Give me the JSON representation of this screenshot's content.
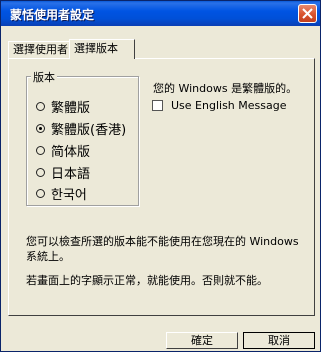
{
  "window": {
    "title": "蒙恬使用者設定"
  },
  "tabs": [
    {
      "label": "選擇使用者"
    },
    {
      "label": "選擇版本"
    }
  ],
  "version_group": {
    "legend": "版本",
    "options": [
      {
        "label": "繁體版",
        "selected": false
      },
      {
        "label": "繁體版(香港)",
        "selected": true
      },
      {
        "label": "简体版",
        "selected": false
      },
      {
        "label": "日本語",
        "selected": false
      },
      {
        "label": "한국어",
        "selected": false
      }
    ]
  },
  "status": {
    "text": "您的 Windows 是繁體版的。"
  },
  "english_option": {
    "label": "Use English Message",
    "checked": false
  },
  "notes": {
    "line1": "您可以檢查所選的版本能不能使用在您現在的 Windows",
    "line2": "系統上。",
    "line3": "若畫面上的字顯示正常，就能使用。否則就不能。"
  },
  "buttons": {
    "ok": "確定",
    "cancel": "取消"
  },
  "colors": {
    "titlebar": "#0054e3",
    "close": "#d9532d",
    "face": "#ece9d8"
  }
}
